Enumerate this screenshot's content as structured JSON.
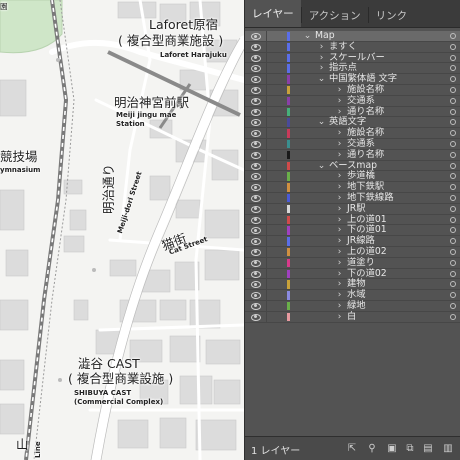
{
  "map": {
    "labels": {
      "laforet_ja": "Laforet原宿",
      "laforet_ja_sub": "( 複合型商業施設 )",
      "laforet_en": "Laforet Harajuku",
      "meiji_ja": "明治神宮前駅",
      "meiji_en1": "Meiji jingu mae",
      "meiji_en2": "Station",
      "kyogijo_ja": "競技場",
      "kyogijo_en": "ymnasium",
      "park_ja": "園",
      "meiji_street_ja": "明治通り",
      "meiji_street_en": "Meiji-dori Street",
      "cat_street_ja": "猫街",
      "cat_street_en": "Cat Street",
      "shibuya_ja": "澁谷 CAST",
      "shibuya_ja_sub": "( 複合型商業設施 )",
      "shibuya_en1": "SHIBUYA CAST",
      "shibuya_en2": "(Commercial Complex)",
      "yamanote_ja": "山",
      "yamanote_en": "Line"
    }
  },
  "panel": {
    "tabs": [
      "レイヤー",
      "アクション",
      "リンク"
    ],
    "active_tab": "レイヤー",
    "layers": [
      {
        "name": "Map",
        "depth": 0,
        "color": "#5a6ee8",
        "expanded": true
      },
      {
        "name": "ますく",
        "depth": 1,
        "color": "#5a6ee8",
        "expanded": false
      },
      {
        "name": "スケールバー",
        "depth": 1,
        "color": "#5a6ee8",
        "expanded": false
      },
      {
        "name": "指示点",
        "depth": 1,
        "color": "#5a6ee8",
        "expanded": false
      },
      {
        "name": "中国繁体語 文字",
        "depth": 1,
        "color": "#8a3fa8",
        "expanded": true
      },
      {
        "name": "施設名称",
        "depth": 2,
        "color": "#c9a23a",
        "expanded": false
      },
      {
        "name": "交通系",
        "depth": 2,
        "color": "#8a3fa8",
        "expanded": false
      },
      {
        "name": "通り名称",
        "depth": 2,
        "color": "#46b07a",
        "expanded": false
      },
      {
        "name": "英語文字",
        "depth": 1,
        "color": "#4a4a9a",
        "expanded": true
      },
      {
        "name": "施設名称",
        "depth": 2,
        "color": "#c93a5a",
        "expanded": false
      },
      {
        "name": "交通系",
        "depth": 2,
        "color": "#3a8f8f",
        "expanded": false
      },
      {
        "name": "通り名称",
        "depth": 2,
        "color": "#1a1a1a",
        "expanded": false
      },
      {
        "name": "ベースmap",
        "depth": 1,
        "color": "#d04a4a",
        "expanded": true
      },
      {
        "name": "歩道橋",
        "depth": 2,
        "color": "#6ab04a",
        "expanded": false
      },
      {
        "name": "地下鉄駅",
        "depth": 2,
        "color": "#d09040",
        "expanded": false
      },
      {
        "name": "地下鉄線路",
        "depth": 2,
        "color": "#4a5ad8",
        "expanded": false
      },
      {
        "name": "JR駅",
        "depth": 2,
        "color": "#d8d8d8",
        "expanded": false
      },
      {
        "name": "上の道01",
        "depth": 2,
        "color": "#d04a4a",
        "expanded": false
      },
      {
        "name": "下の道01",
        "depth": 2,
        "color": "#a040c0",
        "expanded": false
      },
      {
        "name": "JR線路",
        "depth": 2,
        "color": "#5a6ee8",
        "expanded": false
      },
      {
        "name": "上の道02",
        "depth": 2,
        "color": "#d09040",
        "expanded": false
      },
      {
        "name": "道塗り",
        "depth": 2,
        "color": "#d83a8a",
        "expanded": false
      },
      {
        "name": "下の道02",
        "depth": 2,
        "color": "#a040c0",
        "expanded": false
      },
      {
        "name": "建物",
        "depth": 2,
        "color": "#c9a23a",
        "expanded": false
      },
      {
        "name": "水域",
        "depth": 2,
        "color": "#8a8ae0",
        "expanded": false
      },
      {
        "name": "緑地",
        "depth": 2,
        "color": "#6ab04a",
        "expanded": false
      },
      {
        "name": "白",
        "depth": 2,
        "color": "#e89aa0",
        "expanded": false
      }
    ],
    "footer": {
      "layer_count": "1 レイヤー",
      "icons": [
        "export-icon",
        "search-icon",
        "make-mask-icon",
        "new-sublayer-icon",
        "new-layer-icon",
        "trash-icon"
      ]
    }
  }
}
